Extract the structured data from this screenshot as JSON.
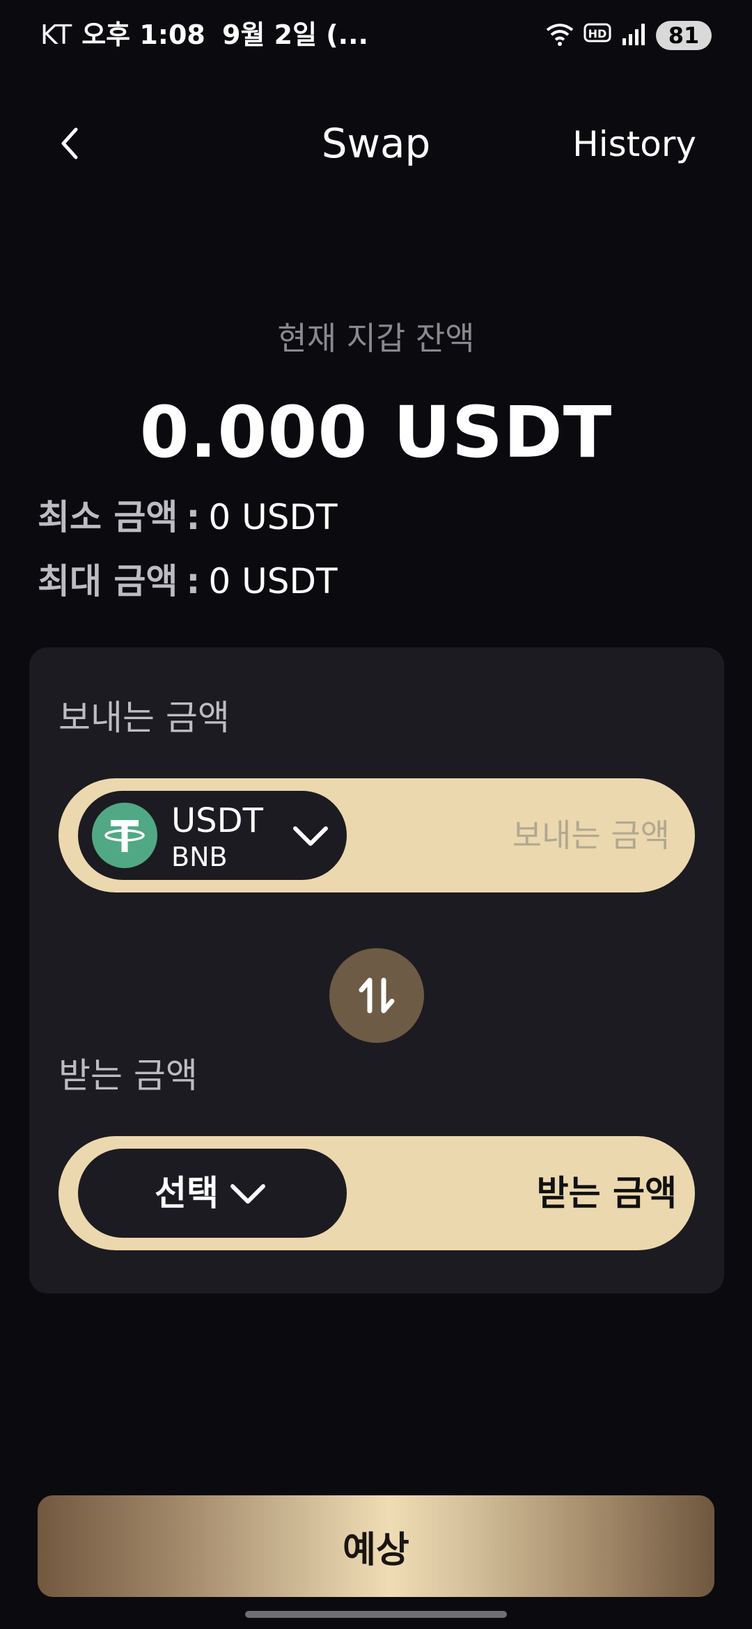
{
  "status_bar": {
    "carrier": "KT",
    "time": "오후 1:08",
    "date": "9월 2일 (...",
    "battery": "81",
    "hd_badge": "HD",
    "icons": [
      "wifi-icon",
      "hd-voice-icon",
      "signal-icon",
      "battery-icon"
    ]
  },
  "header": {
    "title": "Swap",
    "history_label": "History",
    "back_icon": "chevron-left-icon"
  },
  "balance": {
    "label": "현재 지갑 잔액",
    "value": "0.000 USDT"
  },
  "limits": {
    "min_label": "최소 금액",
    "min_value": "0 USDT",
    "max_label": "최대 금액",
    "max_value": "0 USDT",
    "separator": ":"
  },
  "send": {
    "label": "보내는 금액",
    "token_symbol": "USDT",
    "token_network": "BNB",
    "amount_placeholder": "보내는 금액",
    "token_logo_letter": "T"
  },
  "receive": {
    "label": "받는 금액",
    "select_label": "선택",
    "amount_text": "받는 금액"
  },
  "cta": {
    "label": "예상"
  },
  "colors": {
    "background": "#0b0a0e",
    "card": "#1c1b21",
    "pill": "#ecd8ae",
    "swap_button": "#6e5b45",
    "tether_green": "#50a884"
  }
}
